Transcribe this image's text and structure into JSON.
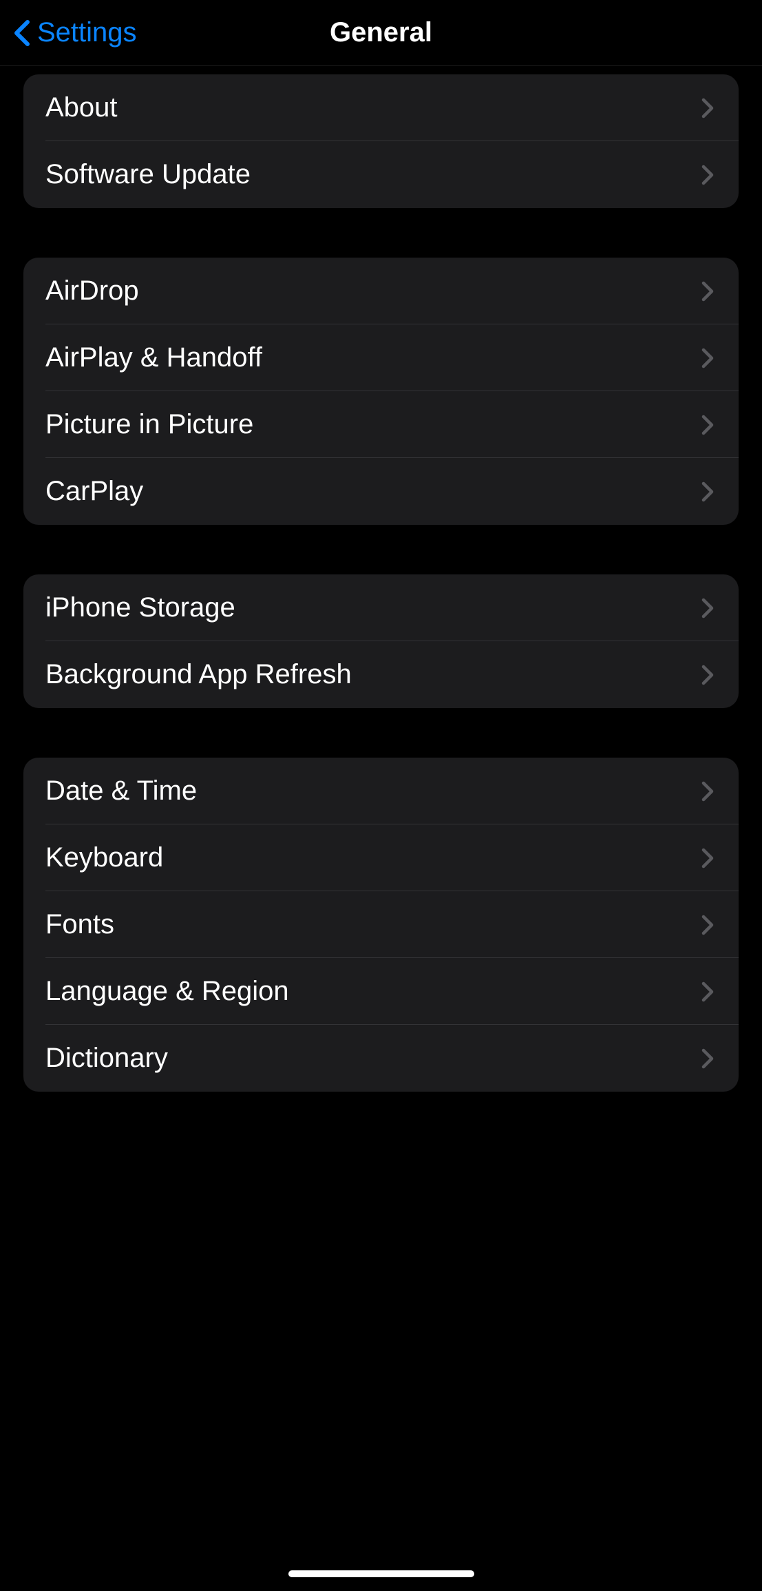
{
  "header": {
    "back_label": "Settings",
    "title": "General"
  },
  "groups": [
    {
      "id": "group-info",
      "items": [
        {
          "id": "about",
          "label": "About"
        },
        {
          "id": "software-update",
          "label": "Software Update"
        }
      ]
    },
    {
      "id": "group-connectivity",
      "items": [
        {
          "id": "airdrop",
          "label": "AirDrop"
        },
        {
          "id": "airplay-handoff",
          "label": "AirPlay & Handoff"
        },
        {
          "id": "picture-in-picture",
          "label": "Picture in Picture"
        },
        {
          "id": "carplay",
          "label": "CarPlay"
        }
      ]
    },
    {
      "id": "group-storage",
      "items": [
        {
          "id": "iphone-storage",
          "label": "iPhone Storage"
        },
        {
          "id": "background-app-refresh",
          "label": "Background App Refresh"
        }
      ]
    },
    {
      "id": "group-preferences",
      "items": [
        {
          "id": "date-time",
          "label": "Date & Time"
        },
        {
          "id": "keyboard",
          "label": "Keyboard"
        },
        {
          "id": "fonts",
          "label": "Fonts"
        },
        {
          "id": "language-region",
          "label": "Language & Region"
        },
        {
          "id": "dictionary",
          "label": "Dictionary"
        }
      ]
    }
  ]
}
